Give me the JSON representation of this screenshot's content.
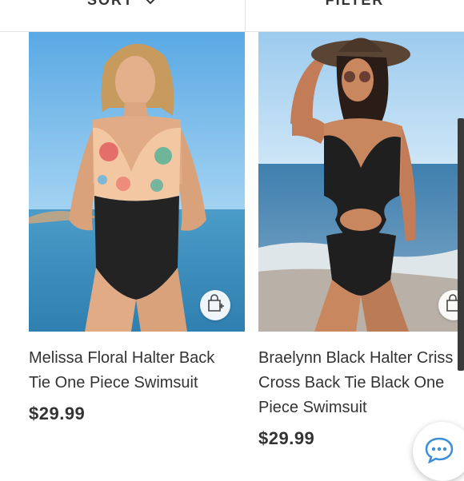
{
  "toolbar": {
    "sort_label": "SORT",
    "filter_label": "FILTER"
  },
  "products": [
    {
      "title": "Melissa Floral Halter Back Tie One Piece Swimsuit",
      "price": "$29.99",
      "image_icon": "swimsuit-photo-floral",
      "action_icon": "add-to-bag-icon"
    },
    {
      "title": "Braelynn Black Halter Criss Cross Back Tie Black One Piece Swimsuit",
      "price": "$29.99",
      "image_icon": "swimsuit-photo-black",
      "action_icon": "add-to-bag-icon"
    }
  ],
  "colors": {
    "text": "#333333",
    "divider": "#e2e2e2",
    "chat_accent": "#3a8fd8"
  },
  "icons": {
    "sort_chevron": "chevron-down-icon",
    "chat": "chat-bubble-icon"
  }
}
